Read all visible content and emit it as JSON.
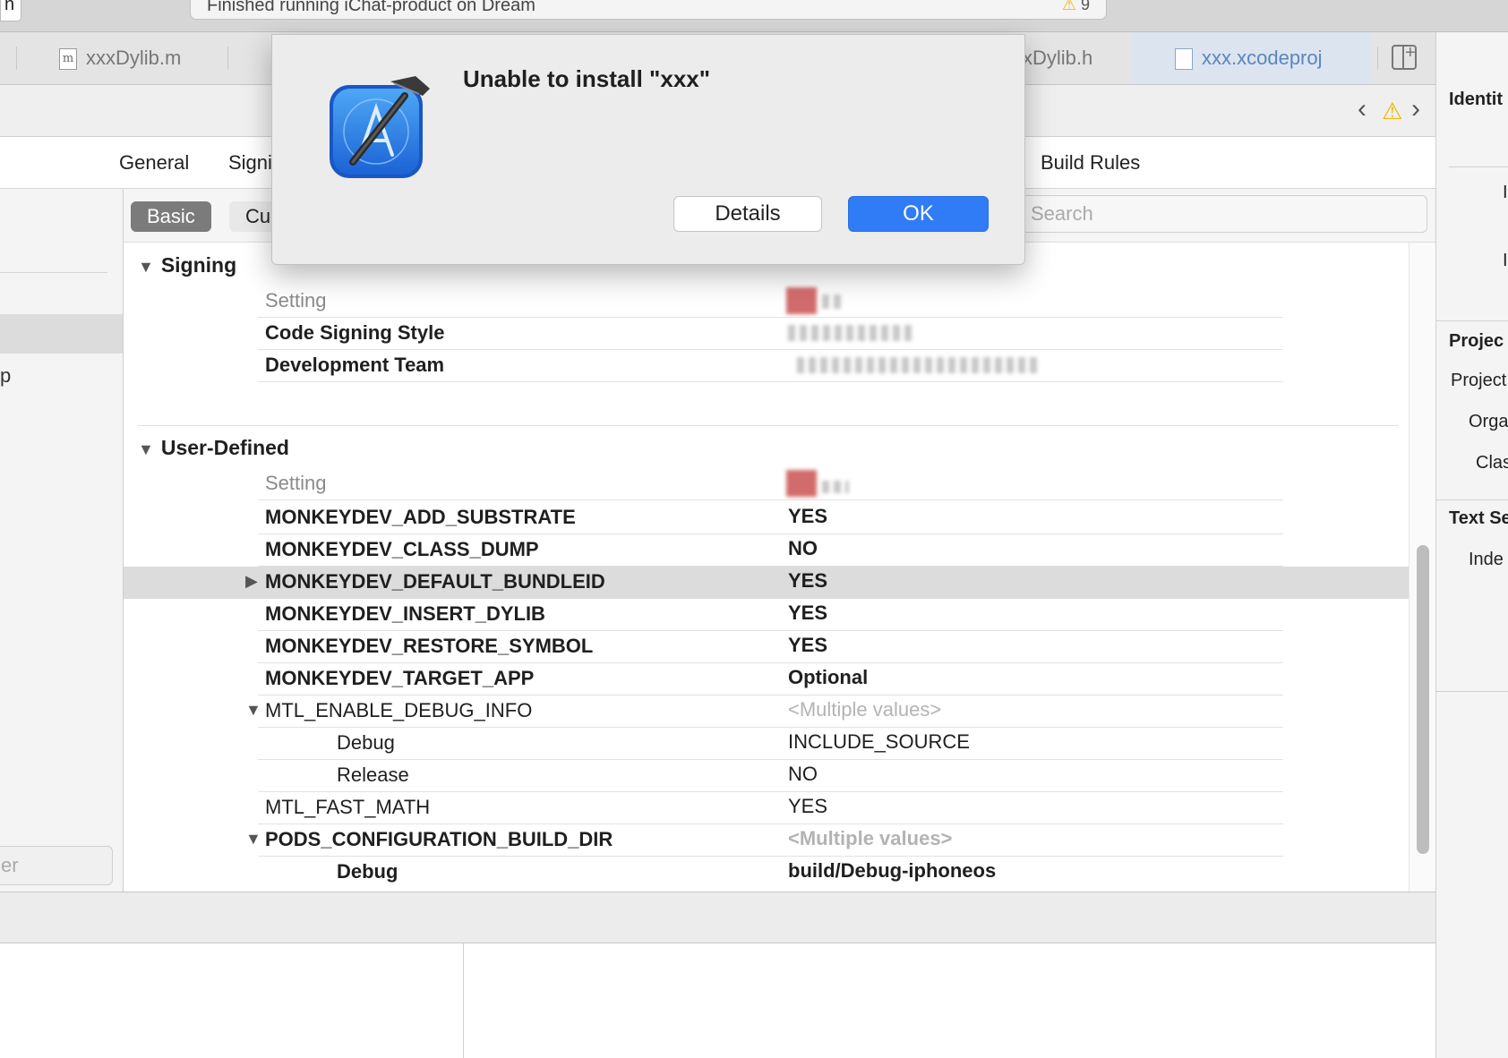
{
  "activity": {
    "status_text": "Finished running iChat-product on Dream",
    "warning_count": "9",
    "stub_text": "n"
  },
  "tabs": [
    {
      "label": "xxxDylib.m",
      "icon_letter": "m"
    },
    {
      "label": "xDylib.h"
    },
    {
      "label": "xxx.xcodeproj"
    }
  ],
  "editor_tabs": {
    "general": "General",
    "signing": "Signi",
    "build_rules": "Build Rules"
  },
  "filter": {
    "basic": "Basic",
    "customized": "Cu",
    "search_placeholder": "Search"
  },
  "sidebar": {
    "item_p": "p",
    "filter_placeholder": "er"
  },
  "inspector": {
    "identity": "Identit",
    "project_doc": "Projec",
    "project_item": "Project",
    "organization": "Orga",
    "class_prefix": "Clas",
    "text_settings": "Text Se",
    "indent": "Inde"
  },
  "signing": {
    "title": "Signing",
    "header_setting": "Setting",
    "rows": [
      {
        "name": "Code Signing Style"
      },
      {
        "name": "Development Team"
      }
    ]
  },
  "user_defined": {
    "title": "User-Defined",
    "header_setting": "Setting",
    "rows": [
      {
        "name": "MONKEYDEV_ADD_SUBSTRATE",
        "value": "YES"
      },
      {
        "name": "MONKEYDEV_CLASS_DUMP",
        "value": "NO"
      },
      {
        "name": "MONKEYDEV_DEFAULT_BUNDLEID",
        "value": "YES"
      },
      {
        "name": "MONKEYDEV_INSERT_DYLIB",
        "value": "YES"
      },
      {
        "name": "MONKEYDEV_RESTORE_SYMBOL",
        "value": "YES"
      },
      {
        "name": "MONKEYDEV_TARGET_APP",
        "value": "Optional"
      },
      {
        "name": "MTL_ENABLE_DEBUG_INFO",
        "value": "<Multiple values>"
      },
      {
        "name": "Debug",
        "value": "INCLUDE_SOURCE"
      },
      {
        "name": "Release",
        "value": "NO"
      },
      {
        "name": "MTL_FAST_MATH",
        "value": "YES"
      },
      {
        "name": "PODS_CONFIGURATION_BUILD_DIR",
        "value": "<Multiple values>"
      },
      {
        "name": "Debug",
        "value": "build/Debug-iphoneos"
      }
    ]
  },
  "dialog": {
    "title": "Unable to install \"xxx\"",
    "details_label": "Details",
    "ok_label": "OK",
    "icon": "xcode-hammer-icon"
  },
  "colors": {
    "accent": "#2f7cf6",
    "tab_active_text": "#5b86bd",
    "warning": "#f0b400"
  }
}
